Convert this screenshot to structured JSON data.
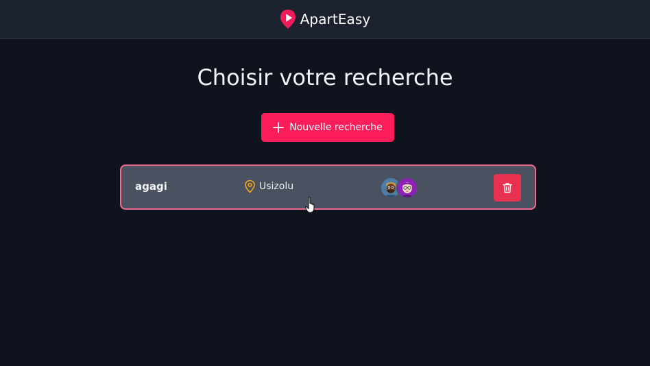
{
  "header": {
    "brand_name": "ApartEasy",
    "logo_icon": "play-badge-logo",
    "accent_color": "#fb1e5b"
  },
  "main": {
    "title": "Choisir votre recherche",
    "new_search_label": "Nouvelle recherche"
  },
  "searches": [
    {
      "name": "agagi",
      "location": "Usizolu",
      "members": [
        {
          "avatar": "bearded-man-avatar",
          "color": "#4b7da8"
        },
        {
          "avatar": "glasses-person-avatar",
          "color": "#8e22b8"
        }
      ],
      "delete_icon": "trash-icon",
      "delete_color": "#e8314f"
    }
  ],
  "colors": {
    "background": "#0f131e",
    "topbar": "#1b222d",
    "card": "#4a5160",
    "card_border": "#f56a8e",
    "pin": "#f5a623"
  }
}
